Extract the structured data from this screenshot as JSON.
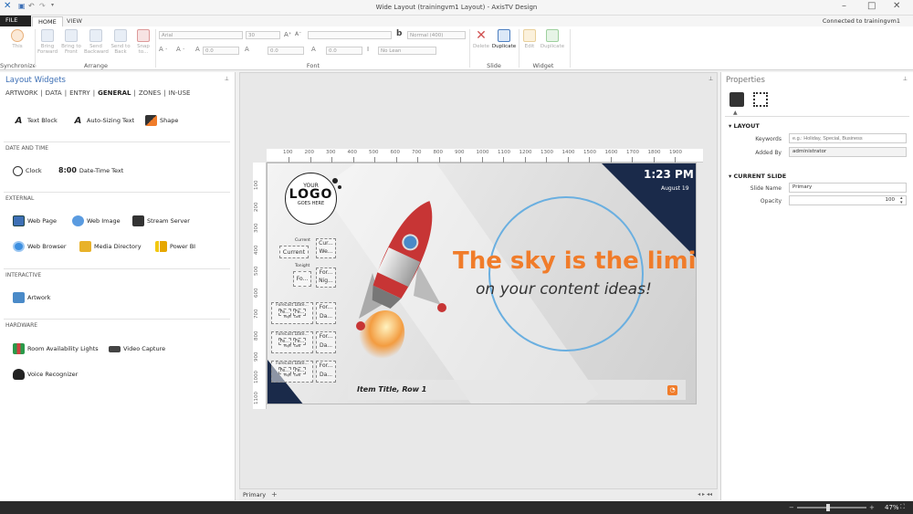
{
  "window": {
    "title": "Wide Layout (trainingvm1 Layout) - AxisTV Design",
    "connection": "Connected to trainingvm1"
  },
  "tabs": {
    "file": "FILE",
    "home": "HOME",
    "view": "VIEW"
  },
  "ribbon": {
    "sync": {
      "this": "This",
      "group": "Synchronize"
    },
    "arrange": {
      "bring_forward": "Bring Forward",
      "bring_to_front": "Bring to Front",
      "send_backward": "Send Backward",
      "send_to_back": "Send to Back",
      "snap_to": "Snap to...",
      "group": "Arrange"
    },
    "font": {
      "family": "Arial",
      "size": "30",
      "weight": "Normal (400)",
      "spacing1": "0.0",
      "spacing2": "0.0",
      "spacing3": "0.0",
      "lean": "No Lean",
      "group": "Font",
      "bold": "b"
    },
    "slide": {
      "delete": "Delete",
      "duplicate": "Duplicate",
      "group": "Slide"
    },
    "widget": {
      "edit": "Edit",
      "duplicate": "Duplicate",
      "group": "Widget"
    }
  },
  "left_panel": {
    "title": "Layout Widgets",
    "categories": [
      "ARTWORK",
      "|",
      "DATA",
      "|",
      "ENTRY",
      "|",
      "GENERAL",
      "|",
      "ZONES",
      "|",
      "IN-USE"
    ],
    "general": {
      "text_block": "Text Block",
      "auto_text": "Auto-Sizing Text",
      "shape": "Shape"
    },
    "date_section": "DATE AND TIME",
    "date": {
      "clock": "Clock",
      "datetime_prefix": "8:00",
      "datetime": "Date-Time Text"
    },
    "external_section": "EXTERNAL",
    "external": {
      "web_page": "Web Page",
      "web_image": "Web Image",
      "stream": "Stream Server",
      "browser": "Web Browser",
      "media_dir": "Media Directory",
      "powerbi": "Power BI"
    },
    "interactive_section": "INTERACTIVE",
    "interactive": {
      "artwork": "Artwork"
    },
    "hardware_section": "HARDWARE",
    "hardware": {
      "room": "Room Availability Lights",
      "video": "Video Capture",
      "voice": "Voice Recognizer"
    }
  },
  "canvas": {
    "ruler_top": [
      "100",
      "200",
      "300",
      "400",
      "500",
      "600",
      "700",
      "800",
      "900",
      "1000",
      "1100",
      "1200",
      "1300",
      "1400",
      "1500",
      "1600",
      "1700",
      "1800",
      "1900"
    ],
    "ruler_left": [
      "100",
      "200",
      "300",
      "400",
      "500",
      "600",
      "700",
      "800",
      "900",
      "1000",
      "1100"
    ],
    "logo": {
      "line1": "YOUR",
      "line2": "LOGO",
      "line3": "GOES HERE"
    },
    "time": "1:23 PM",
    "date": "August 19",
    "headline": "The sky is the limit",
    "subline": "on your content ideas!",
    "ticker": "Item Title, Row 1",
    "weather": {
      "current_label": "Current",
      "current": "Current",
      "cur_a": "Cur...",
      "cur_b": "We...",
      "tonight_label": "Tonight",
      "fo": "Fo...",
      "for_a": "For...",
      "for_b": "Nig...",
      "forecast_date": "Forecast Date...",
      "fe1": "Fe...",
      "fe2": "Fe...",
      "high": "High",
      "low": "Low",
      "for_c": "For...",
      "for_d": "Da..."
    },
    "tab": "Primary",
    "add": "+"
  },
  "right_panel": {
    "title": "Properties",
    "layout_section": "LAYOUT",
    "keywords_label": "Keywords",
    "keywords_placeholder": "e.g.: Holiday, Special, Business",
    "added_by_label": "Added By",
    "added_by": "administrator",
    "slide_section": "CURRENT SLIDE",
    "slide_name_label": "Slide Name",
    "slide_name": "Primary",
    "opacity_label": "Opacity",
    "opacity": "100"
  },
  "status": {
    "zoom": "47%"
  },
  "colors": {
    "accent": "#3d6fb5",
    "headline": "#f07c2a",
    "navy": "#1a2a4a",
    "circle": "#6aafe0"
  }
}
